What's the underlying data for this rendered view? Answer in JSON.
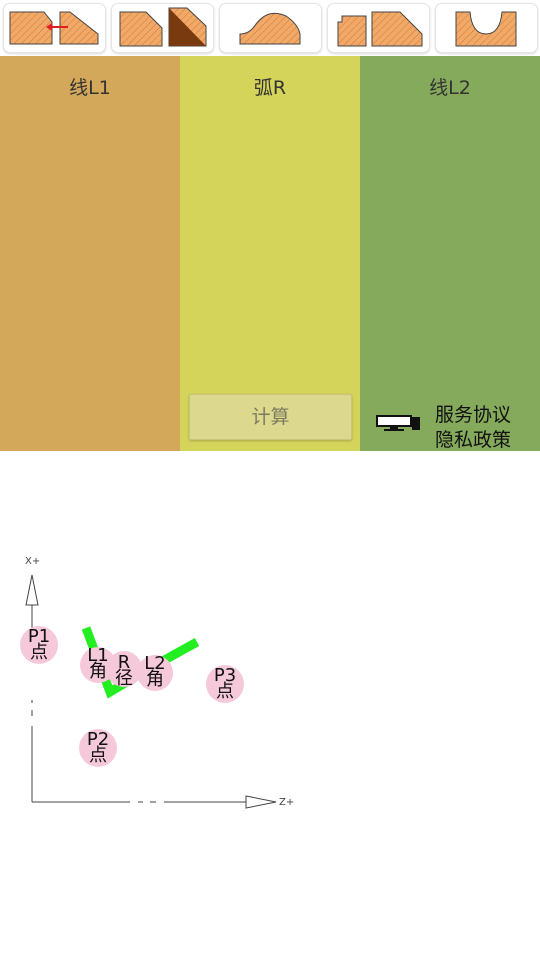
{
  "toolbar": {
    "buttons": [
      {
        "name": "profile-chamfer-arrow",
        "selected_marker": "red-arrow"
      },
      {
        "name": "profile-chamfer-dark"
      },
      {
        "name": "profile-arc-convex"
      },
      {
        "name": "profile-step-chamfer"
      },
      {
        "name": "profile-arc-concave"
      }
    ],
    "colors": {
      "fill": "#f2a968",
      "hatch": "#c97a3a",
      "dark": "#7a3a10",
      "arrow": "#e02020"
    }
  },
  "panels": {
    "l1": {
      "title": "线L1",
      "color": "#d4a85a"
    },
    "r": {
      "title": "弧R",
      "color": "#d4d35a",
      "calc_label": "计算"
    },
    "l2": {
      "title": "线L2",
      "color": "#86aa5b",
      "terms_label": "服务协议",
      "privacy_label": "隐私政策"
    }
  },
  "diagram": {
    "axis_x_label": "X+",
    "axis_z_label": "Z+",
    "points": [
      {
        "id": "p1",
        "line1": "P1",
        "line2": "点"
      },
      {
        "id": "p2",
        "line1": "P2",
        "line2": "点"
      },
      {
        "id": "p3",
        "line1": "P3",
        "line2": "点"
      },
      {
        "id": "l1",
        "line1": "L1",
        "line2": "角"
      },
      {
        "id": "r",
        "line1": "R",
        "line2": "径"
      },
      {
        "id": "l2",
        "line1": "L2",
        "line2": "角"
      }
    ],
    "profile_color": "#22ee22",
    "bubble_color": "#f5c8da"
  }
}
